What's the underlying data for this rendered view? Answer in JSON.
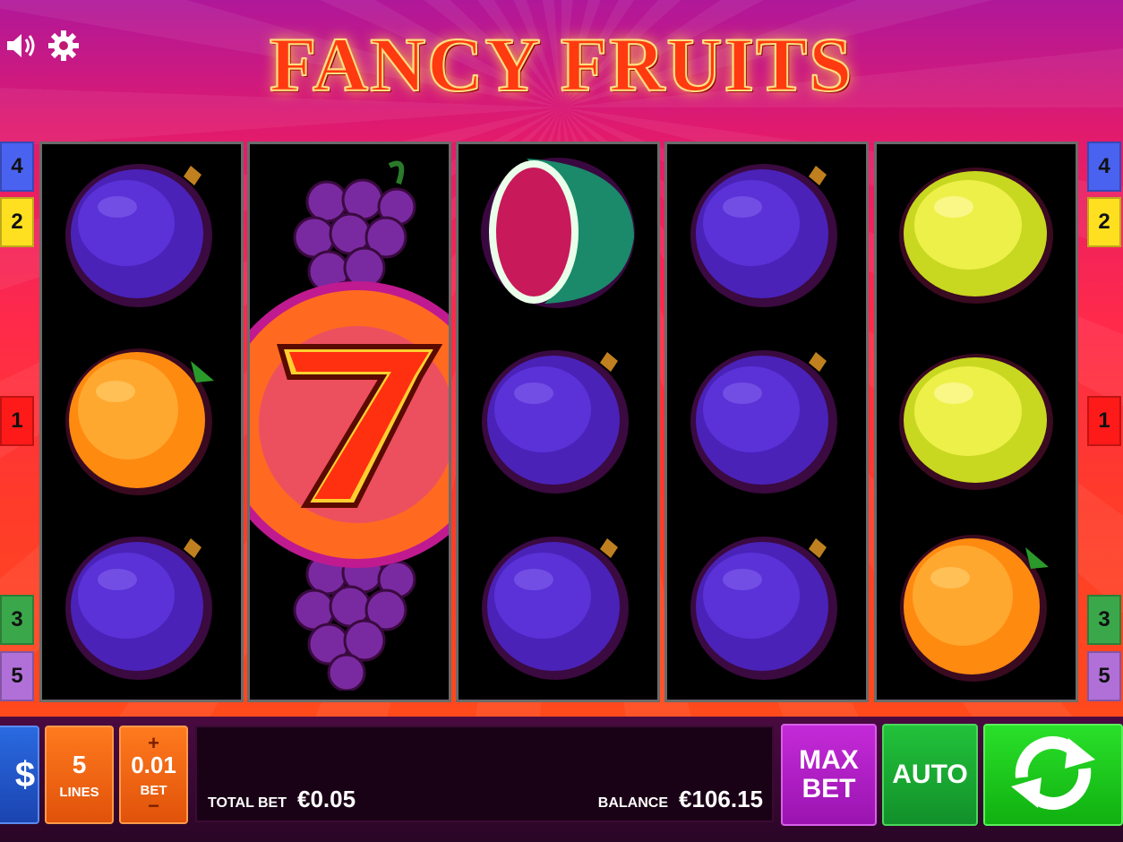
{
  "game": {
    "title": "FANCY FRUITS"
  },
  "icons": {
    "sound": "speaker-icon",
    "settings": "gear-icon"
  },
  "paylines": {
    "left": [
      "4",
      "2",
      "1",
      "3",
      "5"
    ],
    "right": [
      "4",
      "2",
      "1",
      "3",
      "5"
    ]
  },
  "reels": [
    [
      "plum",
      "orange",
      "plum"
    ],
    [
      "grapes",
      "seven",
      "grapes"
    ],
    [
      "watermelon",
      "plum",
      "plum"
    ],
    [
      "plum",
      "plum",
      "plum"
    ],
    [
      "lemon",
      "lemon",
      "orange"
    ]
  ],
  "controls": {
    "lines_value": "5",
    "lines_label": "LINES",
    "bet_value": "0.01",
    "bet_label": "BET",
    "bet_plus": "+",
    "bet_minus": "−",
    "total_bet_label": "TOTAL BET",
    "total_bet_value": "€0.05",
    "balance_label": "BALANCE",
    "balance_value": "€106.15",
    "max_bet_label_1": "MAX",
    "max_bet_label_2": "BET",
    "auto_label": "AUTO",
    "paytable_symbol": "$"
  },
  "colors": {
    "tab_4": "#4a62f0",
    "tab_2": "#ffe020",
    "tab_1": "#ff1a1a",
    "tab_3": "#3aa84a",
    "tab_5": "#b070d8",
    "max_bet": "#b01ec8",
    "auto": "#1aa832",
    "spin": "#1ac81a"
  }
}
